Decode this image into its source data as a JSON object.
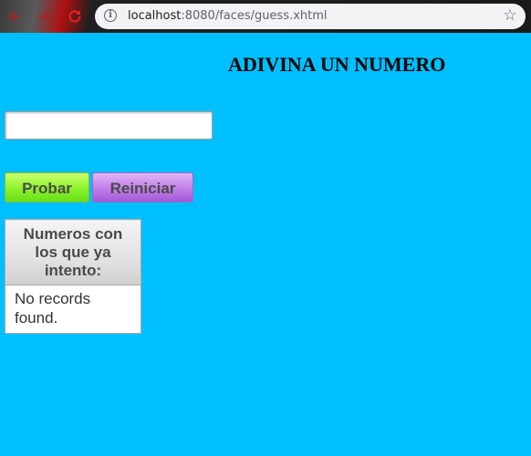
{
  "browser": {
    "url_host": "localhost",
    "url_path": ":8080/faces/guess.xhtml",
    "back_icon": "arrow-left-icon",
    "forward_icon": "arrow-right-icon",
    "reload_icon": "reload-icon",
    "info_icon": "info-icon",
    "bookmark_icon": "star-icon"
  },
  "page": {
    "title": "ADIVINA UN NUMERO",
    "background_color": "#00bfff"
  },
  "form": {
    "guess_value": "",
    "probar_label": "Probar",
    "reiniciar_label": "Reiniciar"
  },
  "attempts_table": {
    "header": "Numeros con los que ya intento:",
    "empty_message": "No records found.",
    "rows": []
  }
}
